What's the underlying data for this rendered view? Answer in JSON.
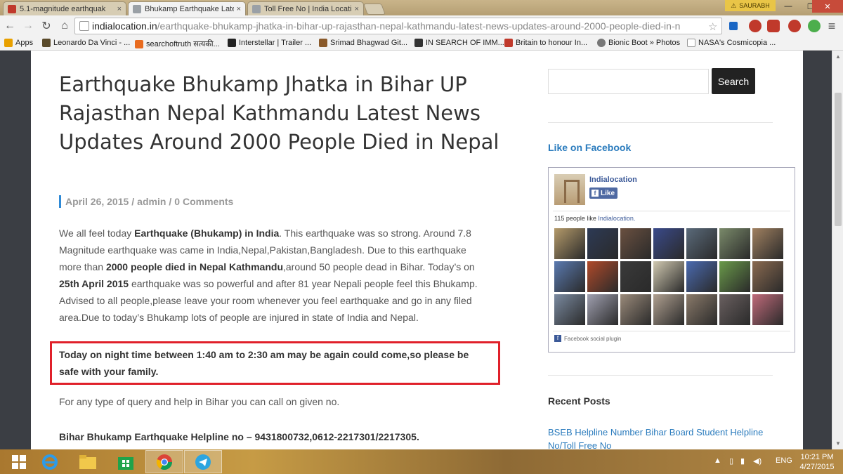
{
  "tabs": [
    {
      "title": "5.1-magnitude earthquak",
      "favicon_color": "#c0392b"
    },
    {
      "title": "Bhukamp Earthquake Late",
      "favicon_color": "#9aa0a6"
    },
    {
      "title": "Toll Free No | India Locati",
      "favicon_color": "#9aa0a6"
    }
  ],
  "user": {
    "name": "SAURABH"
  },
  "toolbar": {
    "url_domain": "indialocation.in",
    "url_path": "/earthquake-bhukamp-jhatka-in-bihar-up-rajasthan-nepal-kathmandu-latest-news-updates-around-2000-people-died-in-n"
  },
  "bookmarks": [
    {
      "label": "Apps",
      "icon_color": "#e8a000"
    },
    {
      "label": "Leonardo Da Vinci - ...",
      "icon_color": "#5a4a2a"
    },
    {
      "label": "searchoftruth सत्यकी...",
      "icon_color": "#e86b1f"
    },
    {
      "label": "Interstellar | Trailer ...",
      "icon_color": "#222"
    },
    {
      "label": "Srimad Bhagwad Git...",
      "icon_color": "#8a5a2a"
    },
    {
      "label": "IN SEARCH OF IMM...",
      "icon_color": "#333"
    },
    {
      "label": "Britain to honour In...",
      "icon_color": "#c0392b"
    },
    {
      "label": "Bionic Boot » Photos",
      "icon_color": "#777"
    },
    {
      "label": "NASA's Cosmicopia ...",
      "icon_color": "#999"
    }
  ],
  "article": {
    "title": "Earthquake Bhukamp Jhatka in Bihar UP Rajasthan Nepal Kathmandu Latest News Updates Around 2000 People Died in Nepal",
    "date": "April 26, 2015",
    "sep": "/",
    "author": "admin",
    "comments": "0 Comments",
    "p1": "We all feel today ",
    "p1_b1": "Earthquake (Bhukamp) in India",
    "p1_2": ". This earthquake was so strong. Around 7.8 Magnitude earthquake was came in India,Nepal,Pakistan,Bangladesh. Due to this earthquake more than ",
    "p1_b2": "2000 people died in Nepal Kathmandu",
    "p1_3": ",around 50 people dead in Bihar. Today’s on ",
    "p1_b3": "25th April 2015",
    "p1_4": " earthquake was so powerful and after 81 year Nepali people feel this Bhukamp. Advised to all people,please leave your room whenever you feel earthquake and go in any filed area.Due to today’s Bhukamp lots of people are injured in state of India and Nepal.",
    "alert": "Today on night time between 1:40 am to 2:30 am may be again could come,so please be safe with your family.",
    "query": "For any type of query and help in Bihar you can call on given no.",
    "helpline": "Bihar Bhukamp Earthquake Helpline no – 9431800732,0612-2217301/2217305."
  },
  "sidebar": {
    "search_button": "Search",
    "search_placeholder": "",
    "fb_heading": "Like on Facebook",
    "fb_page_name": "Indialocation",
    "fb_like_label": "Like",
    "fb_count_text": "115 people like ",
    "fb_count_link": "Indialocation.",
    "fb_plugin_label": "Facebook social plugin",
    "fb_faces": [
      "#b49a6a",
      "#2d3a55",
      "#6a5040",
      "#3a4a8a",
      "#5a6a7a",
      "#7a8a6a",
      "#a08060",
      "#5a7ab0",
      "#b04a2a",
      "#3a3a3a",
      "#d0c8b0",
      "#4a6ab0",
      "#6a9a4a",
      "#8a6a50",
      "#7a8aa0",
      "#a0a0b0",
      "#9a8a7a",
      "#b0a090",
      "#8a7a6a",
      "#6a6060",
      "#c06a7a"
    ],
    "recent_heading": "Recent Posts",
    "recent_link": "BSEB Helpline Number Bihar Board Student Helpline No/Toll Free No"
  },
  "taskbar": {
    "lang": "ENG",
    "time": "10:21 PM",
    "date": "4/27/2015"
  }
}
